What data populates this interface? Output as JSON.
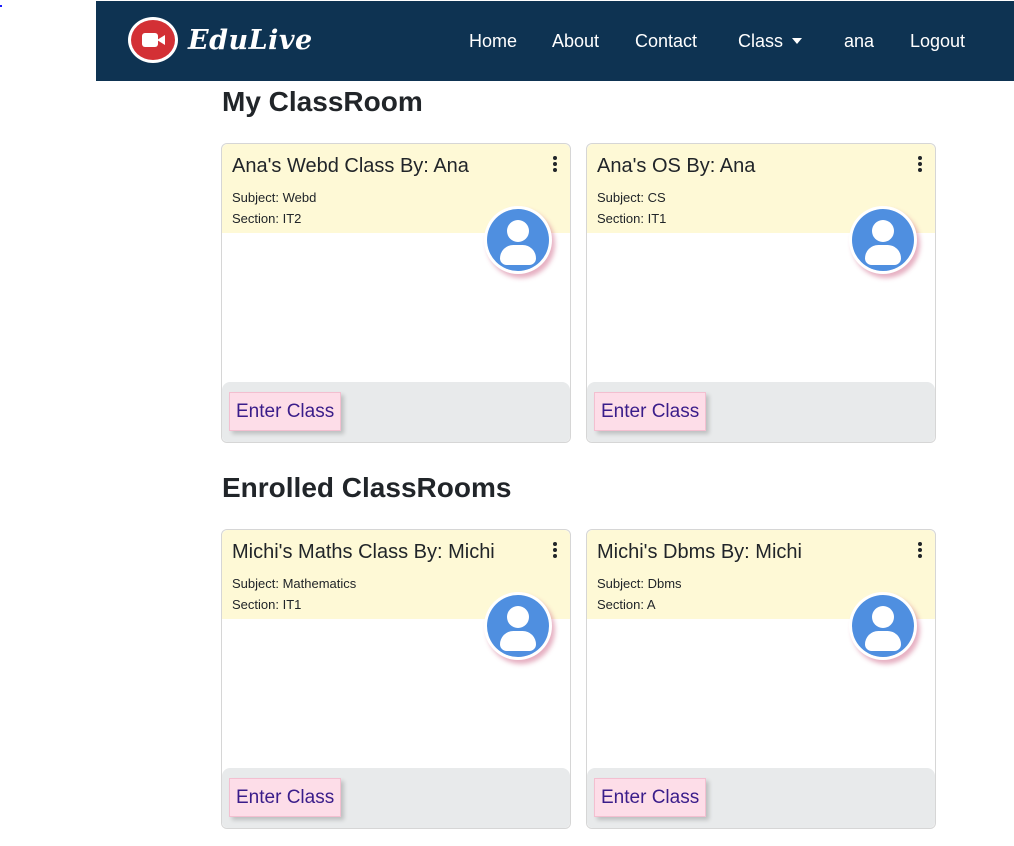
{
  "brand": {
    "name": "EduLive",
    "logo_icon": "video-camera-icon"
  },
  "nav": {
    "home": "Home",
    "about": "About",
    "contact": "Contact",
    "class": "Class",
    "user": "ana",
    "logout": "Logout"
  },
  "my_classroom": {
    "title": "My ClassRoom",
    "cards": [
      {
        "title": "Ana's Webd Class By: Ana",
        "subject": "Subject: Webd",
        "section": "Section: IT2",
        "button": "Enter Class"
      },
      {
        "title": "Ana's OS By: Ana",
        "subject": "Subject: CS",
        "section": "Section: IT1",
        "button": "Enter Class"
      }
    ]
  },
  "enrolled": {
    "title": "Enrolled ClassRooms",
    "cards": [
      {
        "title": "Michi's Maths Class By: Michi",
        "subject": "Subject: Mathematics",
        "section": "Section: IT1",
        "button": "Enter Class"
      },
      {
        "title": "Michi's Dbms By: Michi",
        "subject": "Subject: Dbms",
        "section": "Section: A",
        "button": "Enter Class"
      }
    ]
  },
  "colors": {
    "navbar": "#0e3352",
    "card_header": "#fef9d6",
    "card_footer": "#e8eaeb",
    "button_bg": "#fddde8",
    "avatar": "#4f8fe0",
    "logo": "#d33035"
  }
}
